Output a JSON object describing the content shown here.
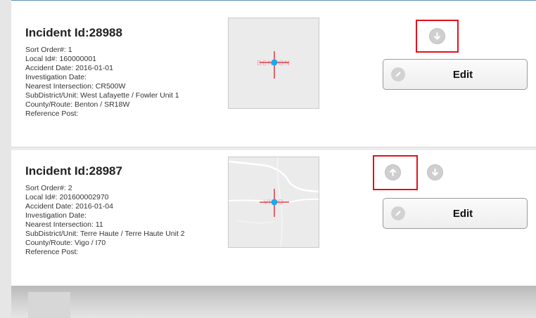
{
  "incidents": [
    {
      "title": "Incident Id:28988",
      "sort_order": "Sort Order#: 1",
      "local_id": "Local Id#: 160000001",
      "accident_date": "Accident Date: 2016-01-01",
      "investigation_date": "Investigation Date:",
      "nearest_intersection": "Nearest Intersection: CR500W",
      "subdistrict_unit": "SubDistrict/Unit: West Lafayette / Fowler Unit 1",
      "county_route": "County/Route: Benton / SR18W",
      "reference_post": "Reference Post:",
      "map_label": "BENTON",
      "edit_label": "Edit",
      "move_buttons": [
        "arrow-down-icon"
      ]
    },
    {
      "title": "Incident Id:28987",
      "sort_order": "Sort Order#: 2",
      "local_id": "Local Id#: 201600002970",
      "accident_date": "Accident Date: 2016-01-04",
      "investigation_date": "Investigation Date:",
      "nearest_intersection": "Nearest Intersection: 11",
      "subdistrict_unit": "SubDistrict/Unit: Terre Haute / Terre Haute Unit 2",
      "county_route": "County/Route: Vigo / I70",
      "reference_post": "Reference Post:",
      "map_label": "VIGO",
      "edit_label": "Edit",
      "move_buttons": [
        "arrow-up-icon",
        "arrow-down-icon"
      ]
    }
  ],
  "colors": {
    "highlight": "#e3101b",
    "marker": "#1ca8f0",
    "crosshair": "#d6202a",
    "icon_button": "#cfcfcf"
  }
}
